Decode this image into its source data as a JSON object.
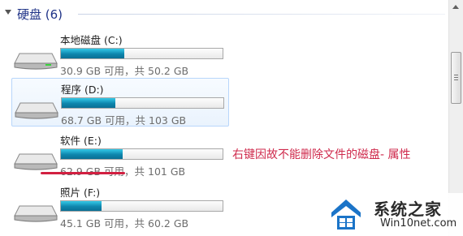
{
  "group": {
    "title": "硬盘 (6)"
  },
  "drives": [
    {
      "name": "本地磁盘 (C:)",
      "used_fraction": 0.39,
      "space": "30.9 GB 可用，共 50.2 GB",
      "selected": false
    },
    {
      "name": "程序 (D:)",
      "used_fraction": 0.33,
      "space": "68.7 GB 可用，共 103 GB",
      "selected": true
    },
    {
      "name": "软件 (E:)",
      "used_fraction": 0.38,
      "space": "62.9 GB 可用，共 101 GB",
      "selected": false
    },
    {
      "name": "照片 (F:)",
      "used_fraction": 0.25,
      "space": "45.1 GB 可用，共 60.2 GB",
      "selected": false
    }
  ],
  "annotation": {
    "text": "右键因故不能删除文件的磁盘- 属性",
    "color": "#cf2a4c"
  },
  "watermark": {
    "brand": "系统之家",
    "url": "Win10net.com"
  },
  "colors": {
    "bar_fill": "#1a9cc4",
    "accent": "#1e3287",
    "selection": "#eaf3fd"
  }
}
